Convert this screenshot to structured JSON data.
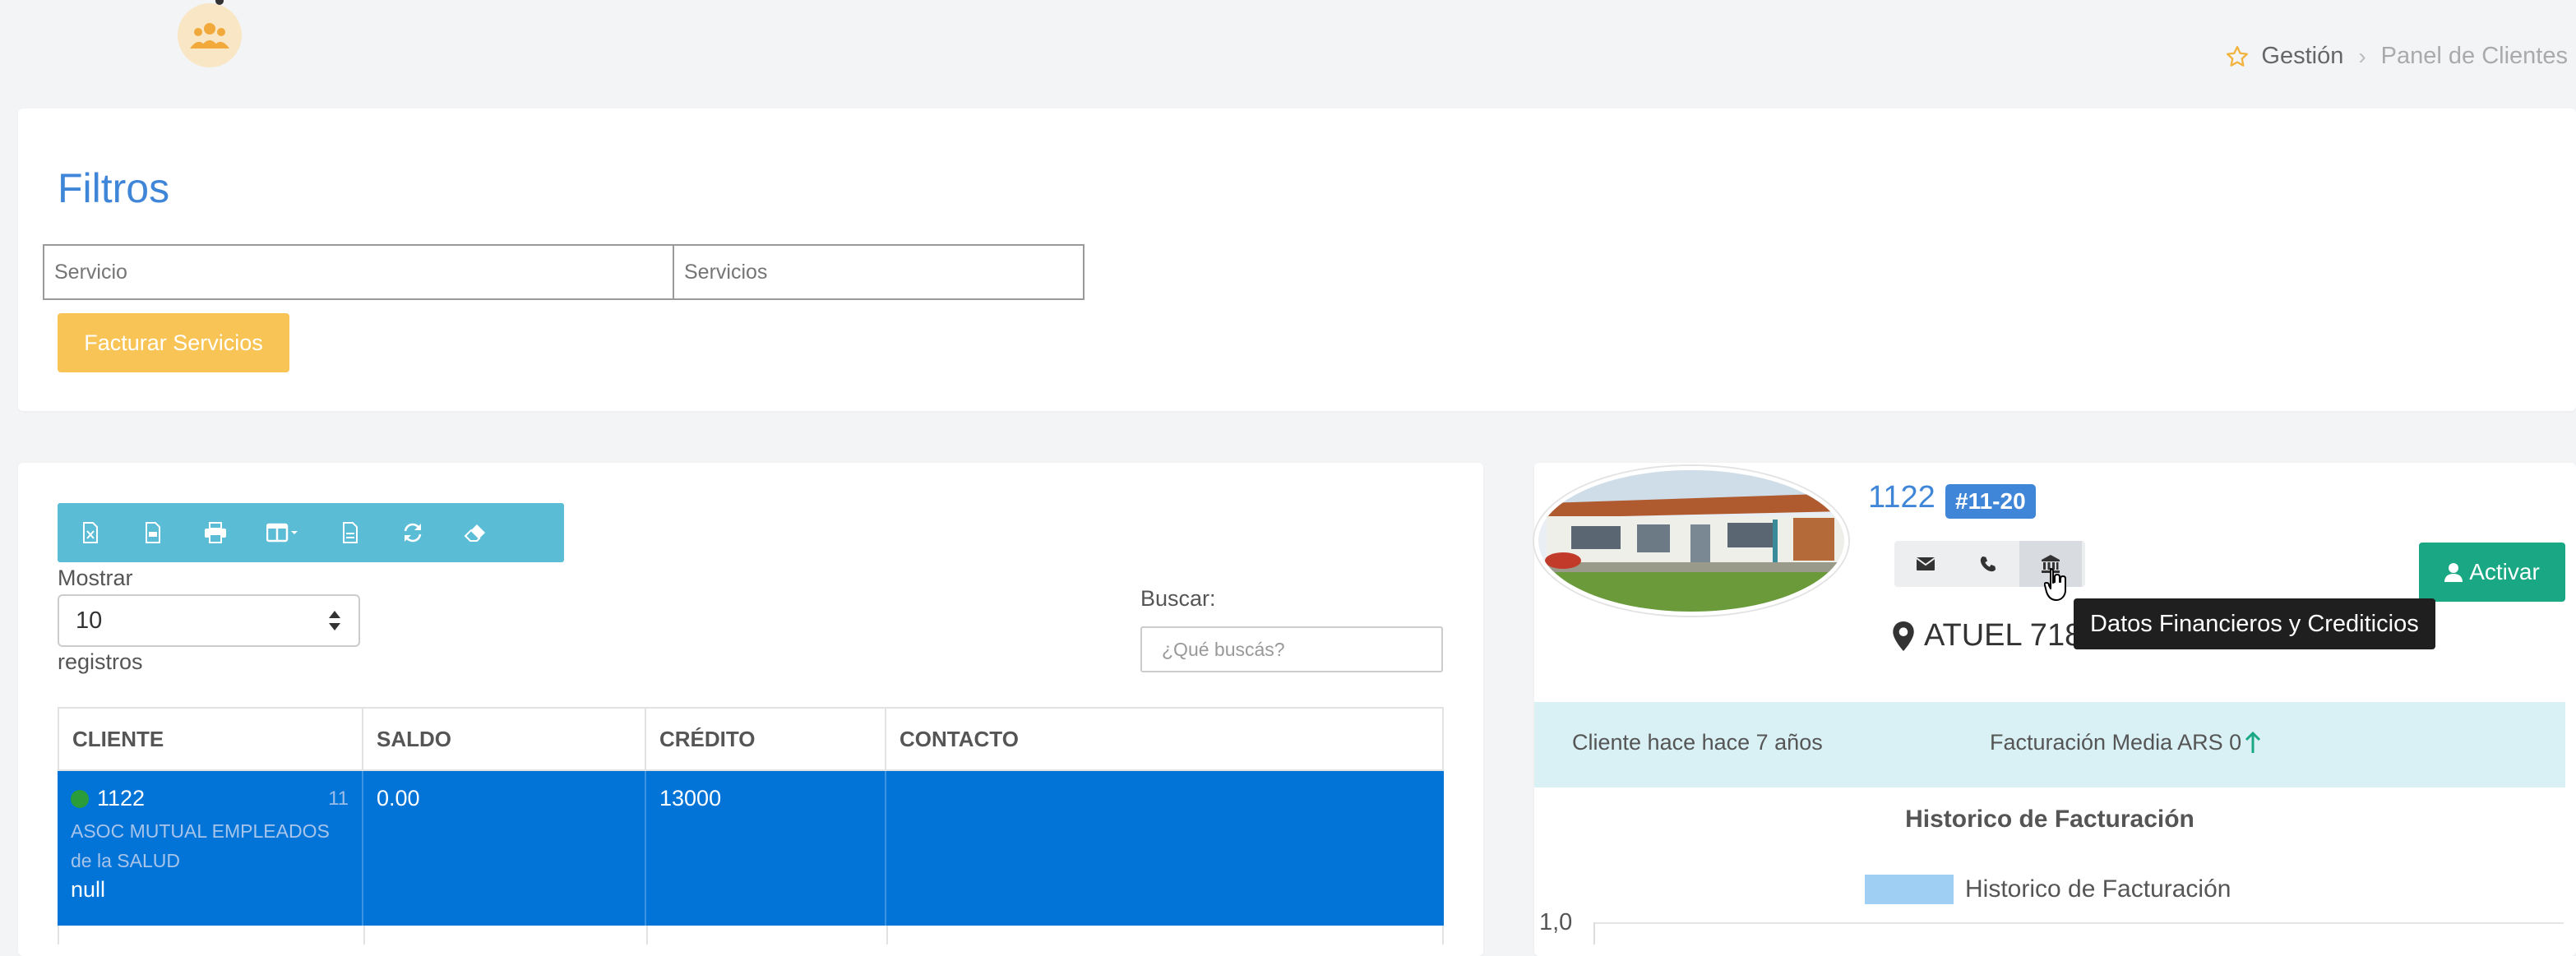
{
  "breadcrumb": {
    "home": "Gestión",
    "current": "Panel de Clientes"
  },
  "filters": {
    "title": "Filtros",
    "servicio_placeholder": "Servicio",
    "servicios_placeholder": "Servicios",
    "facturar_label": "Facturar Servicios"
  },
  "toolbar": {
    "buttons": [
      "excel-icon",
      "pdf-icon",
      "print-icon",
      "columns-icon",
      "csv-icon",
      "refresh-icon",
      "eraser-icon"
    ]
  },
  "list": {
    "mostrar_label": "Mostrar",
    "page_size": "10",
    "registros_label": "registros",
    "buscar_label": "Buscar:",
    "search_placeholder": "¿Qué buscás?"
  },
  "table": {
    "columns": [
      "CLIENTE",
      "SALDO",
      "CRÉDITO",
      "CONTACTO"
    ],
    "rows": [
      {
        "id": "1122",
        "count": "11",
        "name": "ASOC MUTUAL EMPLEADOS de la SALUD",
        "extra": "null",
        "saldo": "0.00",
        "credito": "13000",
        "contacto": "",
        "status_color": "#2a9d3a"
      }
    ]
  },
  "client": {
    "id": "1122",
    "badge": "#11-20",
    "address": "ATUEL 718",
    "activar_label": "Activar",
    "tooltip": "Datos Financieros y Crediticios",
    "since": "Cliente hace hace 7 años",
    "facturacion": "Facturación Media ARS 0"
  },
  "chart_data": {
    "type": "bar",
    "title": "Historico de Facturación",
    "series": [
      {
        "name": "Historico de Facturación",
        "values": []
      }
    ],
    "categories": [],
    "ytick_top": "1,0"
  },
  "colors": {
    "accent_blue": "#3f86d8",
    "selected_row": "#0274d7",
    "warning": "#f8c456",
    "success": "#1aa783",
    "info_toolbar": "#5bbcd6"
  }
}
